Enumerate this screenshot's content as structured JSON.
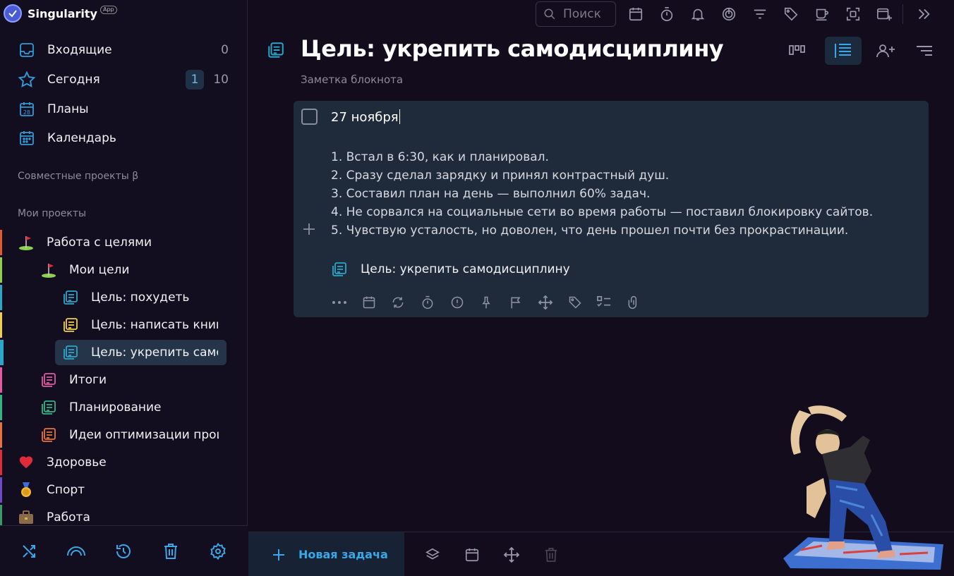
{
  "app": {
    "name": "Singularity",
    "badge": "App"
  },
  "nav": [
    {
      "label": "Входящие",
      "count": "0"
    },
    {
      "label": "Сегодня",
      "count_highlight": "1",
      "count": "10"
    },
    {
      "label": "Планы",
      "count": ""
    },
    {
      "label": "Календарь",
      "count": ""
    }
  ],
  "calendar_icon_day": "28",
  "sections": {
    "shared": "Совместные проекты β",
    "mine": "Мои проекты"
  },
  "projects": [
    {
      "label": "Работа с целями",
      "icon": "golf-flag-icon",
      "color": "#e05a2b"
    },
    {
      "label": "Мои цели",
      "icon": "golf-flag-icon",
      "color": "#8fd14f"
    },
    {
      "label": "Цель: похудеть",
      "icon": "note-icon",
      "color": "#2aa7c9"
    },
    {
      "label": "Цель: написать книг",
      "icon": "note-icon",
      "color": "#f2d046"
    },
    {
      "label": "Цель: укрепить само",
      "icon": "note-icon",
      "color": "#2aa7c9",
      "selected": true
    },
    {
      "label": "Итоги",
      "icon": "note-icon",
      "color": "#e35aa0"
    },
    {
      "label": "Планирование",
      "icon": "note-icon",
      "color": "#33b585"
    },
    {
      "label": "Идеи оптимизации проц",
      "icon": "note-icon",
      "color": "#e8733a"
    },
    {
      "label": "Здоровье",
      "icon": "heart-icon",
      "color": "#e02b3b"
    },
    {
      "label": "Спорт",
      "icon": "medal-icon",
      "color": "#f2b632"
    },
    {
      "label": "Работа",
      "icon": "briefcase-icon",
      "color": "#a07850"
    }
  ],
  "search": {
    "placeholder": "Поиск"
  },
  "header": {
    "title": "Цель: укрепить самодисциплину",
    "subtitle": "Заметка блокнота"
  },
  "task": {
    "title": "27 ноября",
    "notes": [
      "1. Встал в 6:30, как и планировал.",
      "2. Сразу сделал зарядку и принял контрастный душ.",
      "3. Составил план на день — выполнил 60% задач.",
      "4. Не сорвался на социальные сети во время работы — поставил блокировку сайтов.",
      "5. Чувствую усталость, но доволен, что день прошел почти без прокрастинации."
    ],
    "link_label": "Цель: укрепить самодисциплину"
  },
  "bottom": {
    "new_task": "Новая задача"
  },
  "colors": {
    "accent": "#3aa7e8",
    "card": "#1f2a3b",
    "bg": "#120c1d"
  }
}
